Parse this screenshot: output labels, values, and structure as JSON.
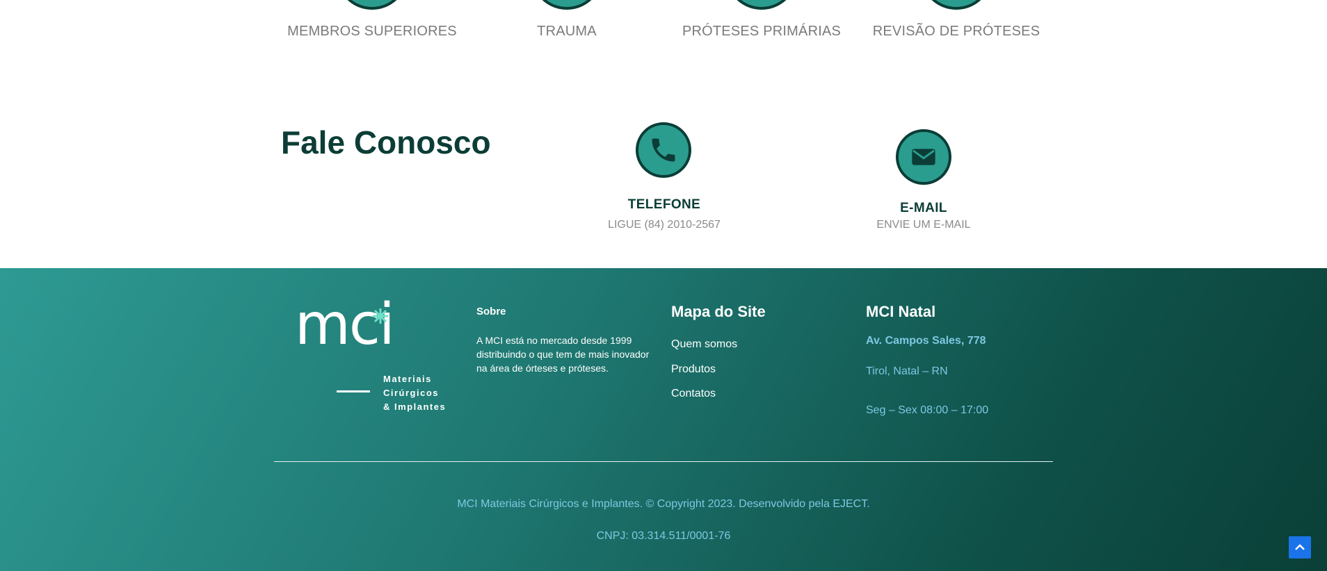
{
  "categories": [
    {
      "label": "MEMBROS SUPERIORES",
      "icon": "upper-limbs-icon"
    },
    {
      "label": "TRAUMA",
      "icon": "trauma-icon"
    },
    {
      "label": "PRÓTESES PRIMÁRIAS",
      "icon": "primary-prosthesis-icon"
    },
    {
      "label": "REVISÃO DE PRÓTESES",
      "icon": "prosthesis-revision-icon"
    }
  ],
  "contact": {
    "title": "Fale Conosco",
    "phone": {
      "title": "TELEFONE",
      "subtitle": "LIGUE (84) 2010-2567",
      "icon": "phone-icon"
    },
    "email": {
      "title": "E-MAIL",
      "subtitle": "ENVIE UM E-MAIL",
      "icon": "envelope-icon"
    }
  },
  "footer": {
    "logo": {
      "wordmark": "mci",
      "tagline_1": "Materiais",
      "tagline_2": "Cirúrgicos",
      "tagline_3": "& Implantes"
    },
    "about": {
      "heading": "Sobre",
      "text": "A MCI está no mercado desde 1999 distribuindo o que tem de mais inovador na área de órteses e próteses."
    },
    "sitemap": {
      "heading": "Mapa do Site",
      "links": [
        "Quem somos",
        "Produtos",
        "Contatos"
      ]
    },
    "location": {
      "heading": "MCI Natal",
      "address": "Av. Campos Sales, 778",
      "city": "Tirol, Natal – RN",
      "hours": "Seg – Sex 08:00 – 17:00"
    },
    "copyright": "MCI Materiais Cirúrgicos e Implantes. © Copyright 2023. Desenvolvido pela EJECT.",
    "cnpj": "CNPJ: 03.314.511/0001-76"
  },
  "colors": {
    "primary_dark": "#0b3d36",
    "teal": "#2a9d8f",
    "link_blue": "#7ec8e3",
    "scroll_top_button": "#1a73e8"
  },
  "scroll_top_icon": "chevron-up-icon"
}
